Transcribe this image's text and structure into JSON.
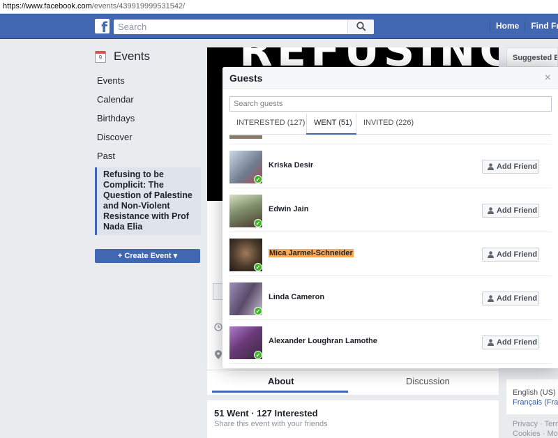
{
  "browser": {
    "url_host": "https://www.facebook.com",
    "url_path": "/events/439919999531542/"
  },
  "topbar": {
    "search_placeholder": "Search",
    "home_label": "Home",
    "find_friends_label": "Find Frie"
  },
  "leftnav": {
    "title": "Events",
    "calendar_day": "9",
    "items": [
      {
        "label": "Events"
      },
      {
        "label": "Calendar"
      },
      {
        "label": "Birthdays"
      },
      {
        "label": "Discover"
      },
      {
        "label": "Past"
      }
    ],
    "selected_event": "Refusing to be Complicit: The Question of Palestine and Non-Violent Resistance with Prof Nada Elia",
    "create_label": "+ Create Event ▾"
  },
  "cover": {
    "text": "REFUSING"
  },
  "event_tabs": {
    "about": "About",
    "discussion": "Discussion"
  },
  "attendance": {
    "summary": "51 Went · 127 Interested",
    "share_text": "Share this event with your friends"
  },
  "rightcol": {
    "suggested_label": "Suggested Ev",
    "lang_current": "English (US)",
    "lang_alt": "Français (Fran",
    "footer_line1": "Privacy · Term",
    "footer_line2": "Cookies · More"
  },
  "guests_modal": {
    "title": "Guests",
    "close": "×",
    "search_placeholder": "Search guests",
    "tabs": [
      {
        "label": "INTERESTED (127)"
      },
      {
        "label": "WENT (51)"
      },
      {
        "label": "INVITED (226)"
      }
    ],
    "active_tab": "WENT (51)",
    "add_friend_label": "Add Friend",
    "guests": [
      {
        "name": "Kriska Desir",
        "photo_color": "#7f8c9a"
      },
      {
        "name": "Edwin Jain",
        "photo_color": "#8f9e6a"
      },
      {
        "name": "Mica Jarmel-Schneider",
        "photo_color": "#3d3328",
        "highlighted": true
      },
      {
        "name": "Linda Cameron",
        "photo_color": "#8c7fa6"
      },
      {
        "name": "Alexander Loughran Lamothe",
        "photo_color": "#7a5a8c"
      }
    ]
  }
}
